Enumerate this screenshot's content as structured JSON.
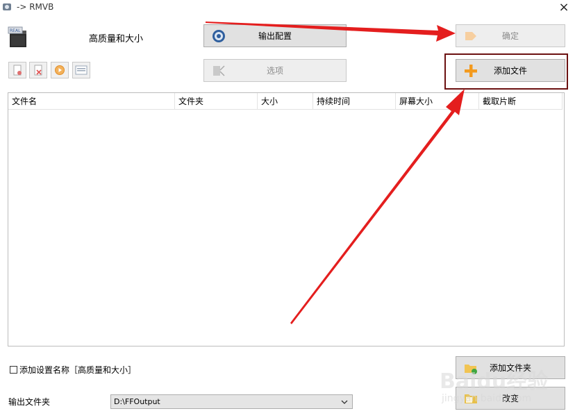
{
  "window": {
    "title": "-> RMVB",
    "close_glyph": "×"
  },
  "header": {
    "format_label": "高质量和大小"
  },
  "buttons": {
    "output_config": "输出配置",
    "options": "选项",
    "ok": "确定",
    "add_file": "添加文件",
    "add_folder": "添加文件夹",
    "change": "改变"
  },
  "table": {
    "columns": [
      "文件名",
      "文件夹",
      "大小",
      "持续时间",
      "屏幕大小",
      "截取片断"
    ],
    "rows": []
  },
  "footer": {
    "checkbox_label": "添加设置名称［高质量和大小］",
    "checkbox_checked": false,
    "output_folder_label": "输出文件夹",
    "output_folder_value": "D:\\FFOutput"
  },
  "watermark": {
    "text": "Baidu经验",
    "sub": "jingyan.baidu.com"
  },
  "colors": {
    "annotation_arrow": "#e41e1e",
    "highlight_box": "#6b1010",
    "plus_icon": "#f39a1e"
  }
}
